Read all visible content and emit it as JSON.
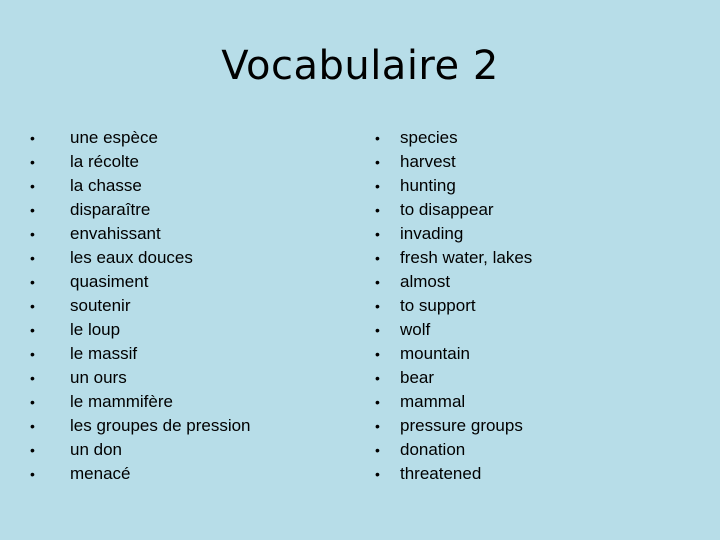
{
  "slide": {
    "title": "Vocabulaire 2",
    "bullet_glyph": "•",
    "french_terms": [
      "une espèce",
      "la récolte",
      "la chasse",
      "disparaître",
      "envahissant",
      "les eaux douces",
      "quasiment",
      "soutenir",
      "le loup",
      "le massif",
      "un ours",
      "le mammifère",
      "les groupes de pression",
      "un don",
      "menacé"
    ],
    "english_terms": [
      "species",
      "harvest",
      "hunting",
      "to disappear",
      "invading",
      "fresh water, lakes",
      "almost",
      "to support",
      "wolf",
      "mountain",
      "bear",
      "mammal",
      "pressure groups",
      "donation",
      "threatened"
    ]
  }
}
